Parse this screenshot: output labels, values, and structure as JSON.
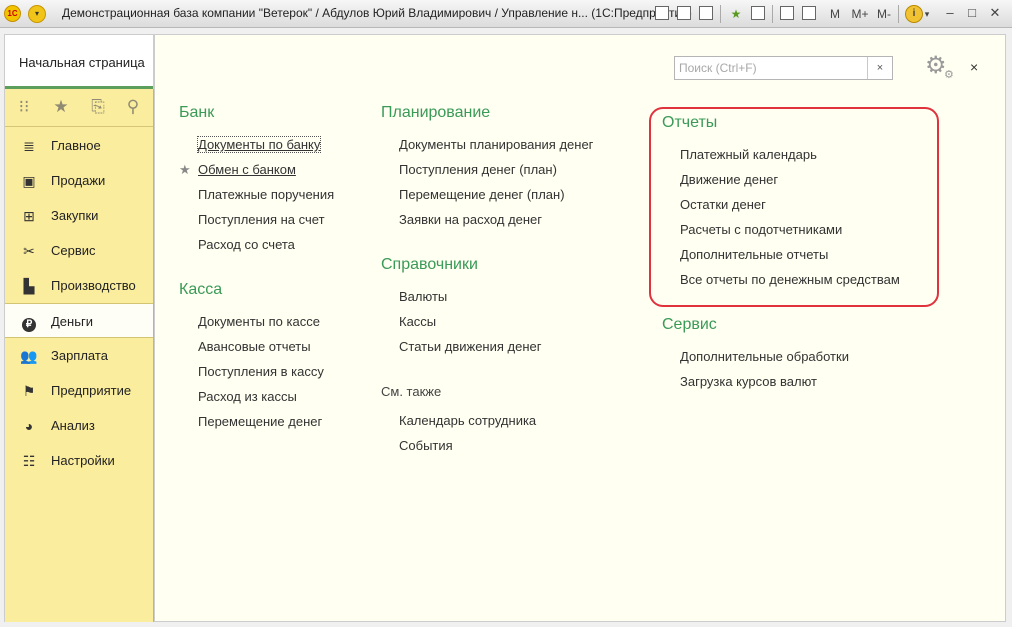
{
  "titlebar": {
    "title": "Демонстрационная база компании \"Ветерок\" / Абдулов Юрий Владимирович / Управление н...  (1С:Предприятие)",
    "logo_text": "1С",
    "btn_m": "M",
    "btn_mplus": "M+",
    "btn_mminus": "M-",
    "info_label": "i"
  },
  "tab": {
    "label": "Начальная страница"
  },
  "search": {
    "placeholder": "Поиск (Ctrl+F)",
    "clear": "×"
  },
  "close_label": "×",
  "sidebar": {
    "items": [
      {
        "label": "Главное",
        "icon": "list-icon"
      },
      {
        "label": "Продажи",
        "icon": "basket-icon"
      },
      {
        "label": "Закупки",
        "icon": "cart-icon"
      },
      {
        "label": "Сервис",
        "icon": "tools-icon"
      },
      {
        "label": "Производство",
        "icon": "factory-icon"
      },
      {
        "label": "Деньги",
        "icon": "ruble-icon",
        "active": true
      },
      {
        "label": "Зарплата",
        "icon": "people-icon"
      },
      {
        "label": "Предприятие",
        "icon": "flag-icon"
      },
      {
        "label": "Анализ",
        "icon": "pie-icon"
      },
      {
        "label": "Настройки",
        "icon": "settings-icon"
      }
    ]
  },
  "sections": {
    "bank": {
      "title": "Банк",
      "items": [
        "Документы по банку",
        "Обмен с банком",
        "Платежные поручения",
        "Поступления на счет",
        "Расход со счета"
      ]
    },
    "cash": {
      "title": "Касса",
      "items": [
        "Документы по кассе",
        "Авансовые отчеты",
        "Поступления в кассу",
        "Расход из кассы",
        "Перемещение денег"
      ]
    },
    "planning": {
      "title": "Планирование",
      "items": [
        "Документы планирования денег",
        "Поступления денег (план)",
        "Перемещение денег (план)",
        "Заявки на расход денег"
      ]
    },
    "refs": {
      "title": "Справочники",
      "items": [
        "Валюты",
        "Кассы",
        "Статьи движения денег"
      ]
    },
    "see_also": {
      "title": "См. также",
      "items": [
        "Календарь сотрудника",
        "События"
      ]
    },
    "reports": {
      "title": "Отчеты",
      "items": [
        "Платежный календарь",
        "Движение денег",
        "Остатки денег",
        "Расчеты с подотчетниками",
        "Дополнительные отчеты",
        "Все отчеты по денежным средствам"
      ]
    },
    "service": {
      "title": "Сервис",
      "items": [
        "Дополнительные обработки",
        "Загрузка курсов валют"
      ]
    }
  },
  "colors": {
    "section_title": "#3a9a57",
    "sidebar_bg": "#fbed9e",
    "highlight": "#e0333d"
  }
}
